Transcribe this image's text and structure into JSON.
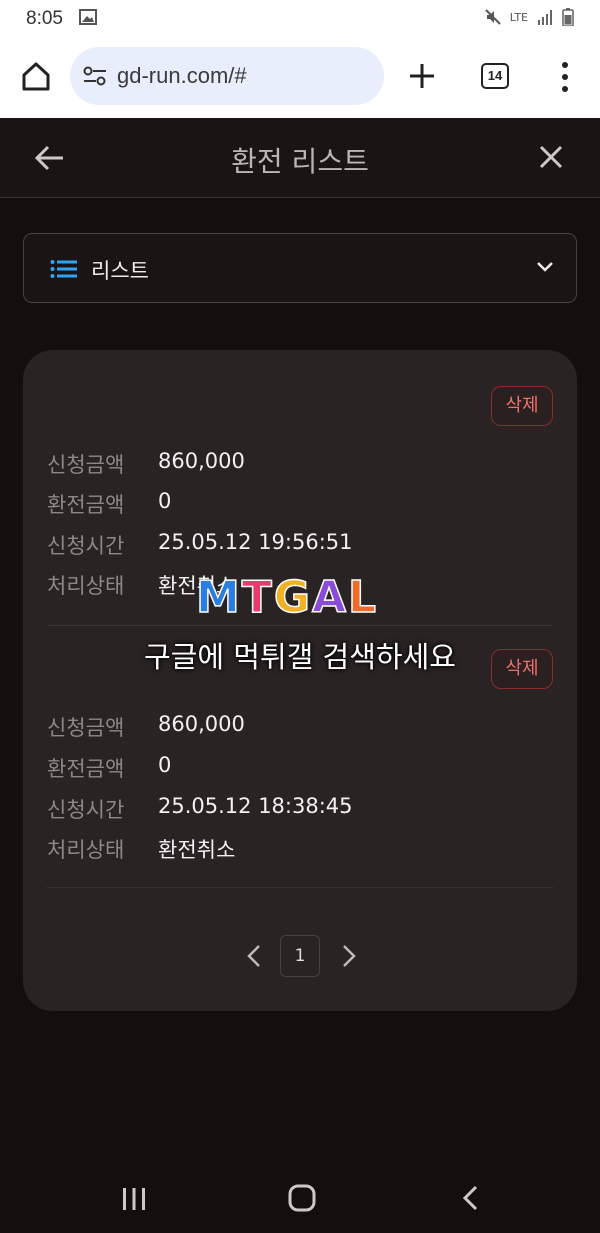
{
  "status_bar": {
    "time": "8:05",
    "network": "LTE"
  },
  "browser": {
    "url": "gd-run.com/#",
    "tab_count": "14"
  },
  "header": {
    "title": "환전 리스트"
  },
  "select": {
    "label": "리스트"
  },
  "labels": {
    "request_amount": "신청금액",
    "exchange_amount": "환전금액",
    "request_time": "신청시간",
    "status": "처리상태",
    "delete": "삭제"
  },
  "records": [
    {
      "request_amount": "860,000",
      "exchange_amount": "0",
      "request_time": "25.05.12 19:56:51",
      "status": "환전취소"
    },
    {
      "request_amount": "860,000",
      "exchange_amount": "0",
      "request_time": "25.05.12 18:38:45",
      "status": "환전취소"
    }
  ],
  "pagination": {
    "current": "1"
  },
  "watermark": {
    "logo": "MTGAL",
    "text": "구글에 먹튀갤 검색하세요"
  },
  "colors": {
    "background": "#140f0f",
    "card": "#2a2323",
    "delete_red": "#ef7070",
    "accent_blue": "#2ea3f2"
  }
}
